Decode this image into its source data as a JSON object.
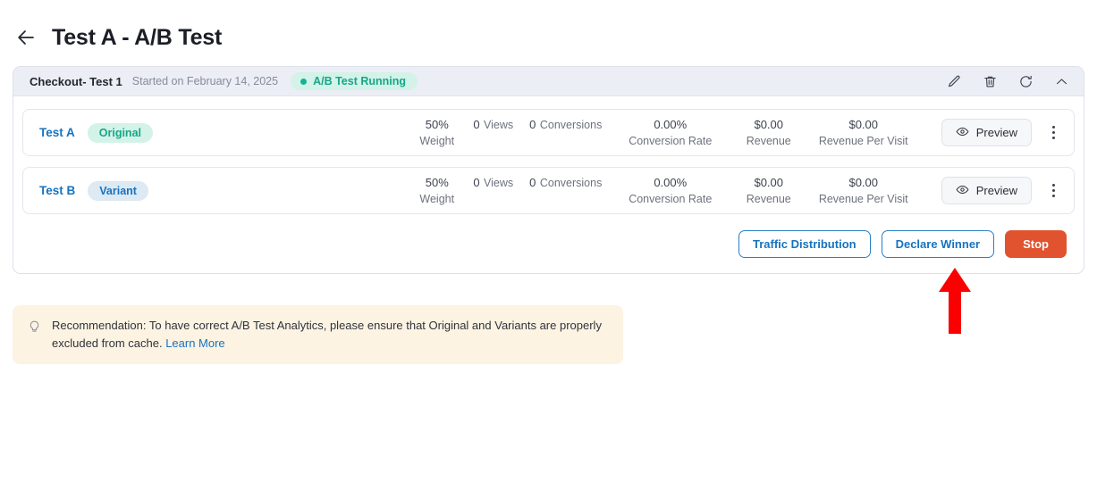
{
  "header": {
    "back_icon": "arrow-left-icon",
    "title": "Test A - A/B Test"
  },
  "test_card": {
    "name": "Checkout- Test 1",
    "started": "Started on February 14, 2025",
    "status": "A/B Test Running",
    "status_color": "#17a589",
    "status_bg": "#d3f3e8",
    "actions": {
      "edit": "edit-pencil-icon",
      "delete": "trash-icon",
      "refresh": "refresh-icon",
      "collapse": "chevron-up-icon"
    },
    "metric_labels": {
      "weight": "Weight",
      "views": "Views",
      "conversions": "Conversions",
      "conversion_rate": "Conversion Rate",
      "revenue": "Revenue",
      "revenue_per_visit": "Revenue Per Visit"
    },
    "preview_label": "Preview",
    "variants": [
      {
        "name": "Test A",
        "type": "Original",
        "weight": "50%",
        "views": "0",
        "conversions": "0",
        "conversion_rate": "0.00%",
        "revenue": "$0.00",
        "revenue_per_visit": "$0.00"
      },
      {
        "name": "Test B",
        "type": "Variant",
        "weight": "50%",
        "views": "0",
        "conversions": "0",
        "conversion_rate": "0.00%",
        "revenue": "$0.00",
        "revenue_per_visit": "$0.00"
      }
    ],
    "footer_buttons": {
      "traffic_distribution": "Traffic Distribution",
      "declare_winner": "Declare Winner",
      "stop": "Stop",
      "stop_color": "#e0532e",
      "outline_color": "#1673c0"
    }
  },
  "recommendation": {
    "icon": "lightbulb-icon",
    "text": "Recommendation: To have correct A/B Test Analytics, please ensure that Original and Variants are properly excluded from cache. ",
    "link": "Learn More",
    "bg": "#fdf3e3"
  },
  "annotation": {
    "arrow": "red-up-arrow",
    "color": "#fb0000"
  }
}
